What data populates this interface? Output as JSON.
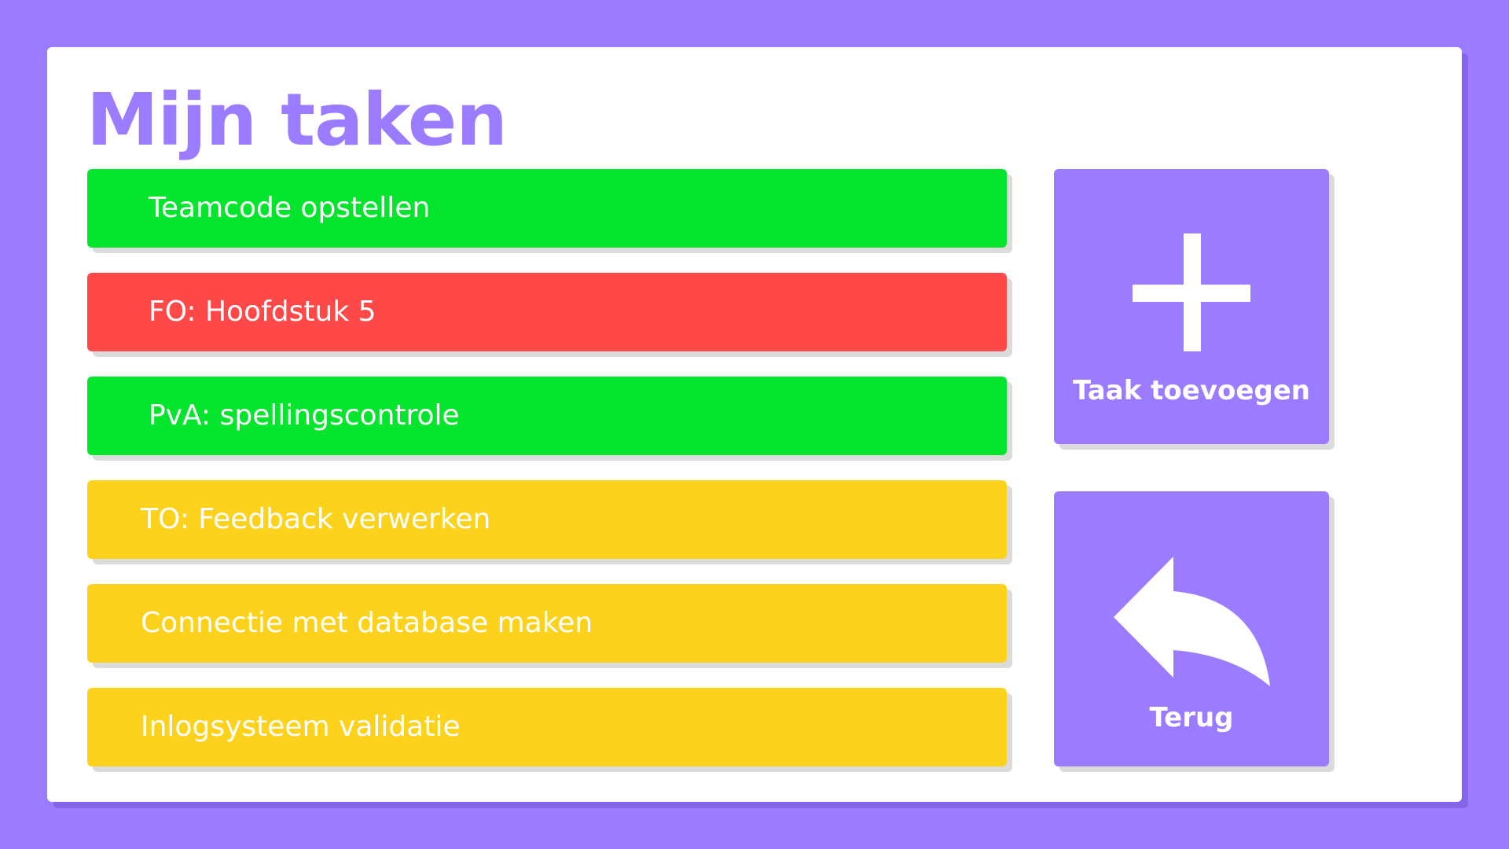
{
  "page": {
    "title": "Mijn taken"
  },
  "tasks": [
    {
      "label": "Teamcode opstellen",
      "status_color": "#06e52e"
    },
    {
      "label": "FO: Hoofdstuk 5",
      "status_color": "#ff4848"
    },
    {
      "label": "PvA: spellingscontrole",
      "status_color": "#06e52e"
    },
    {
      "label": "TO: Feedback verwerken",
      "status_color": "#fdd21c"
    },
    {
      "label": "Connectie met database maken",
      "status_color": "#fdd21c"
    },
    {
      "label": "Inlogsysteem validatie",
      "status_color": "#fdd21c"
    }
  ],
  "actions": {
    "add": {
      "label": "Taak toevoegen",
      "icon": "plus-icon"
    },
    "back": {
      "label": "Terug",
      "icon": "back-arrow-icon"
    }
  },
  "colors": {
    "accent": "#9b7bff",
    "done": "#06e52e",
    "blocked": "#ff4848",
    "in_progress": "#fdd21c"
  }
}
